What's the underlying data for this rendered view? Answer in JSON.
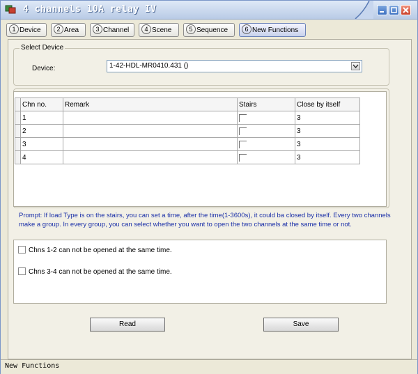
{
  "window": {
    "title": "4 channels 10A relay IV",
    "status_text": "New Functions"
  },
  "tabs": [
    {
      "num": "1",
      "label": "Device"
    },
    {
      "num": "2",
      "label": "Area"
    },
    {
      "num": "3",
      "label": "Channel"
    },
    {
      "num": "4",
      "label": "Scene"
    },
    {
      "num": "5",
      "label": "Sequence"
    },
    {
      "num": "6",
      "label": "New Functions",
      "active": true
    }
  ],
  "select_device": {
    "legend": "Select Device",
    "label": "Device:",
    "value": "1-42-HDL-MR0410.431 ()"
  },
  "table": {
    "headers": [
      "Chn no.",
      "Remark",
      "Stairs",
      "Close by itself"
    ],
    "rows": [
      {
        "chn": "1",
        "remark": "",
        "stairs": false,
        "close": "3"
      },
      {
        "chn": "2",
        "remark": "",
        "stairs": false,
        "close": "3"
      },
      {
        "chn": "3",
        "remark": "",
        "stairs": false,
        "close": "3"
      },
      {
        "chn": "4",
        "remark": "",
        "stairs": false,
        "close": "3"
      }
    ]
  },
  "prompt": "Prompt: If load Type is on the stairs, you can set a time, after the time(1-3600s), it could ba closed by itself. Every two channels make a group. In every group, you can select whether you want to open the two channels at the same time or not.",
  "options": [
    {
      "label": "Chns 1-2 can not be opened at the same time.",
      "checked": false
    },
    {
      "label": "Chns 3-4 can not be opened at the same time.",
      "checked": false
    }
  ],
  "buttons": {
    "read": "Read",
    "save": "Save"
  }
}
